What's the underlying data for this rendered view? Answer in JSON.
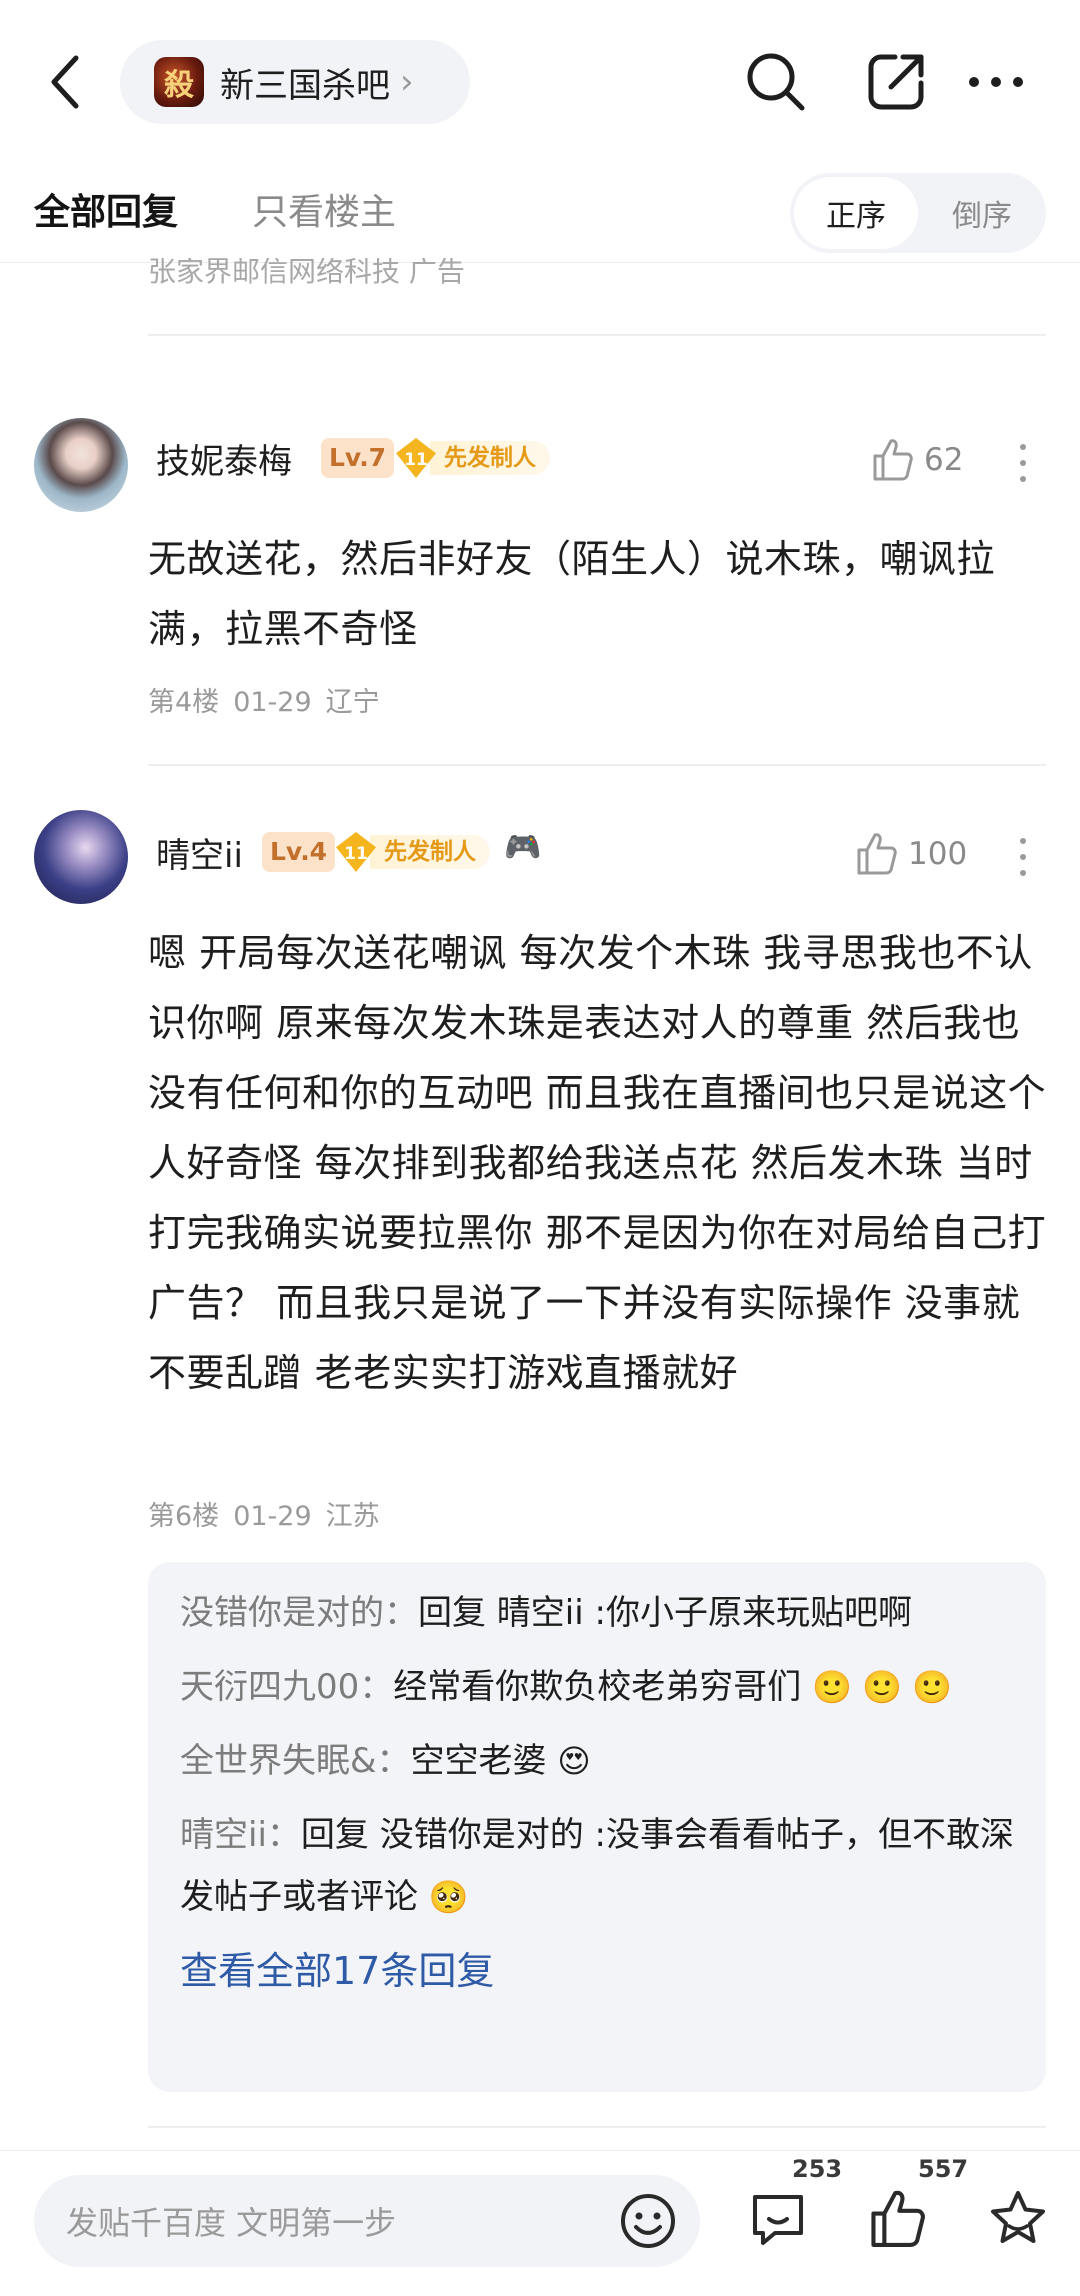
{
  "header": {
    "forum_name": "新三国杀吧",
    "forum_logo_char": "殺",
    "chevron": "›"
  },
  "tabs": {
    "all_replies": "全部回复",
    "owner_only": "只看楼主",
    "order_asc": "正序",
    "order_desc": "倒序"
  },
  "ad_remnant": "张家界邮信网络科技  广告",
  "posts": [
    {
      "username": "技妮泰梅",
      "level": "Lv.7",
      "badge_num": "11",
      "badge_text": "先发制人",
      "likes": "62",
      "content": "无故送花，然后非好友（陌生人）说木珠，嘲讽拉满，拉黑不奇怪",
      "floor": "第4楼",
      "date": "01-29",
      "location": "辽宁"
    },
    {
      "username": "晴空ii",
      "level": "Lv.4",
      "badge_num": "11",
      "badge_text": "先发制人",
      "extra_emoji": "🎮",
      "likes": "100",
      "content": "嗯 开局每次送花嘲讽 每次发个木珠 我寻思我也不认识你啊 原来每次发木珠是表达对人的尊重 然后我也没有任何和你的互动吧 而且我在直播间也只是说这个人好奇怪 每次排到我都给我送点花 然后发木珠 当时打完我确实说要拉黑你 那不是因为你在对局给自己打广告？ 而且我只是说了一下并没有实际操作 没事就不要乱蹭 老老实实打游戏直播就好",
      "floor": "第6楼",
      "date": "01-29",
      "location": "江苏",
      "replies": [
        {
          "user": "没错你是对的",
          "text": "回复 晴空ii :你小子原来玩贴吧啊",
          "emoji": ""
        },
        {
          "user": "天衍四九00",
          "text": "经常看你欺负校老弟穷哥们",
          "emoji": "🙂 🙂 🙂"
        },
        {
          "user": "全世界失眠&",
          "text": "空空老婆",
          "emoji": "😍"
        },
        {
          "user": "晴空ii",
          "text": "回复 没错你是对的 :没事会看看帖子，但不敢深发帖子或者评论",
          "emoji": "🥺"
        }
      ],
      "view_all": "查看全部17条回复"
    }
  ],
  "bottom": {
    "compose_placeholder": "发贴千百度 文明第一步",
    "comment_count": "253",
    "like_count": "557"
  }
}
